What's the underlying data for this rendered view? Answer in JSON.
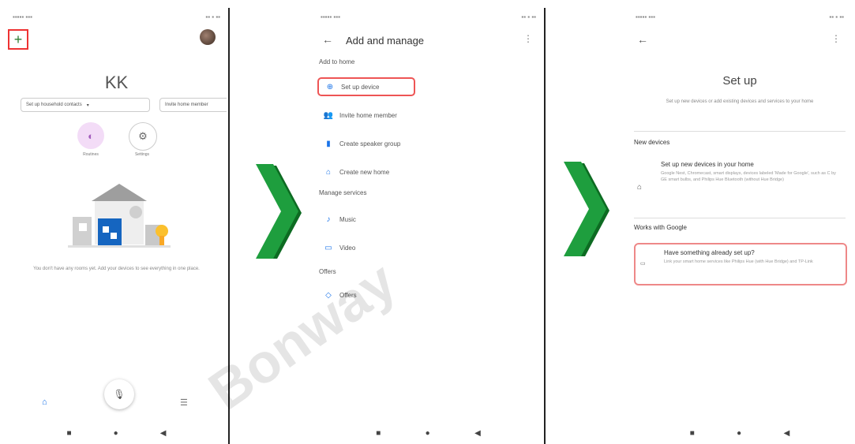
{
  "colors": {
    "accent_blue": "#1a73e8",
    "highlight_red": "#e33333",
    "arrow_green": "#1e9e3e",
    "arrow_green_dark": "#0d6b22"
  },
  "screen1": {
    "home_name": "KK",
    "chip_left": "Set up household contacts",
    "chip_right": "Invite home member",
    "routines_label": "Routines",
    "settings_label": "Settings",
    "empty_text": "You don't have any rooms yet. Add your devices to see everything in one place."
  },
  "screen2": {
    "title": "Add and manage",
    "section_add": "Add to home",
    "item_setup": "Set up device",
    "item_invite": "Invite home member",
    "item_speaker": "Create speaker group",
    "item_newhome": "Create new home",
    "section_manage": "Manage services",
    "item_music": "Music",
    "item_video": "Video",
    "section_offers": "Offers",
    "item_offers": "Offers"
  },
  "screen3": {
    "title": "Set up",
    "subtitle": "Set up new devices or add existing devices and services to your home",
    "section_new": "New devices",
    "new_title": "Set up new devices in your home",
    "new_desc": "Google Nest, Chromecast, smart displays, devices labeled 'Made for Google', such as C by GE smart bulbs, and Philips Hue Bluetooth (without Hue Bridge)",
    "section_works": "Works with Google",
    "works_title": "Have something already set up?",
    "works_desc": "Link your smart home services like Philips Hue (with Hue Bridge) and TP-Link"
  },
  "watermark": "Bonway"
}
